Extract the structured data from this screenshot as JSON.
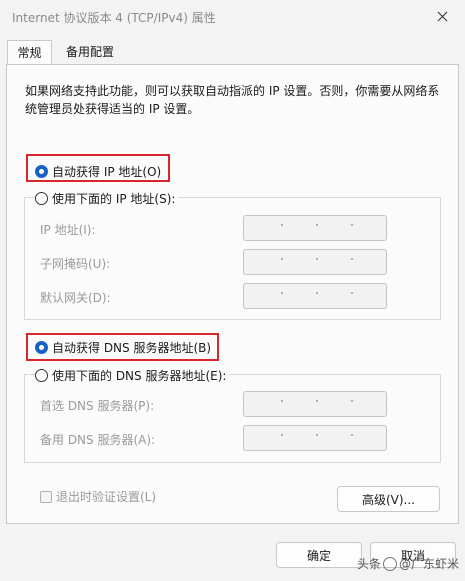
{
  "window": {
    "title": "Internet 协议版本 4 (TCP/IPv4) 属性"
  },
  "tabs": [
    {
      "label": "常规"
    },
    {
      "label": "备用配置"
    }
  ],
  "general": {
    "intro": "如果网络支持此功能，则可以获取自动指派的 IP 设置。否则，你需要从网络系统管理员处获得适当的 IP 设置。",
    "ip_auto": {
      "label": "自动获得 IP 地址(O)",
      "checked": true
    },
    "ip_manual": {
      "label": "使用下面的 IP 地址(S):",
      "checked": false
    },
    "ip_fields": [
      {
        "label": "IP 地址(I):"
      },
      {
        "label": "子网掩码(U):"
      },
      {
        "label": "默认网关(D):"
      }
    ],
    "dns_auto": {
      "label": "自动获得 DNS 服务器地址(B)",
      "checked": true
    },
    "dns_manual": {
      "label": "使用下面的 DNS 服务器地址(E):",
      "checked": false
    },
    "dns_fields": [
      {
        "label": "首选 DNS 服务器(P):"
      },
      {
        "label": "备用 DNS 服务器(A):"
      }
    ],
    "validate": {
      "label": "退出时验证设置(L)",
      "checked": false
    },
    "advanced_label": "高级(V)..."
  },
  "buttons": {
    "ok": "确定",
    "cancel": "取消"
  },
  "watermark": {
    "prefix": "头条",
    "handle": "@广东虾米"
  },
  "colors": {
    "accent": "#1862c4",
    "highlight_box": "#d6272c"
  }
}
